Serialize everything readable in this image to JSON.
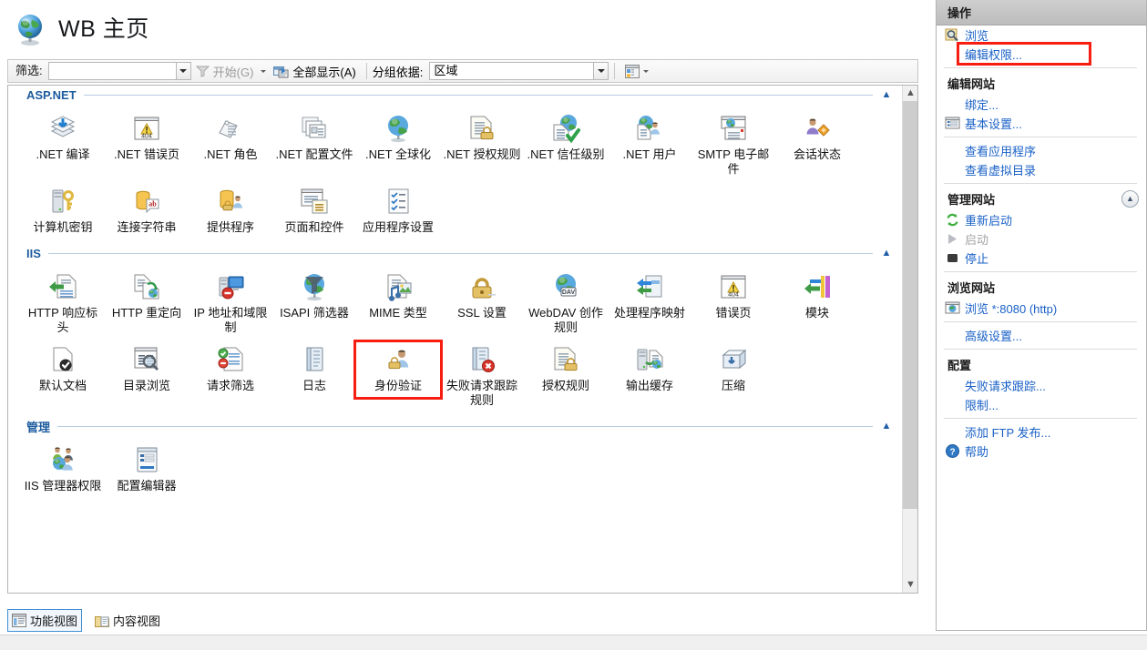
{
  "page": {
    "title": "WB 主页",
    "title_icon": "globe-icon"
  },
  "toolbar": {
    "filter_label": "筛选:",
    "filter_value": "",
    "filter_placeholder": "",
    "start_label": "开始(G)",
    "show_all_label": "全部显示(A)",
    "group_by_label": "分组依据:",
    "group_by_value": "区域"
  },
  "groups": [
    {
      "title": "ASP.NET",
      "items": [
        {
          "label": ".NET 编译",
          "icon": "net-compilation-icon",
          "highlight": false
        },
        {
          "label": ".NET 错误页",
          "icon": "net-error-pages-icon",
          "highlight": false
        },
        {
          "label": ".NET 角色",
          "icon": "net-roles-icon",
          "highlight": false
        },
        {
          "label": ".NET 配置文件",
          "icon": "net-profile-icon",
          "highlight": false
        },
        {
          "label": ".NET 全球化",
          "icon": "net-globalization-icon",
          "highlight": false
        },
        {
          "label": ".NET 授权规则",
          "icon": "net-authorization-icon",
          "highlight": false
        },
        {
          "label": ".NET 信任级别",
          "icon": "net-trust-levels-icon",
          "highlight": false
        },
        {
          "label": ".NET 用户",
          "icon": "net-users-icon",
          "highlight": false
        },
        {
          "label": "SMTP 电子邮件",
          "icon": "smtp-email-icon",
          "highlight": false
        },
        {
          "label": "会话状态",
          "icon": "session-state-icon",
          "highlight": false
        },
        {
          "label": "计算机密钥",
          "icon": "machine-key-icon",
          "highlight": false
        },
        {
          "label": "连接字符串",
          "icon": "connection-strings-icon",
          "highlight": false
        },
        {
          "label": "提供程序",
          "icon": "providers-icon",
          "highlight": false
        },
        {
          "label": "页面和控件",
          "icon": "pages-controls-icon",
          "highlight": false
        },
        {
          "label": "应用程序设置",
          "icon": "app-settings-icon",
          "highlight": false
        }
      ]
    },
    {
      "title": "IIS",
      "items": [
        {
          "label": "HTTP 响应标头",
          "icon": "http-response-headers-icon",
          "highlight": false
        },
        {
          "label": "HTTP 重定向",
          "icon": "http-redirect-icon",
          "highlight": false
        },
        {
          "label": "IP 地址和域限制",
          "icon": "ip-restrictions-icon",
          "highlight": false
        },
        {
          "label": "ISAPI 筛选器",
          "icon": "isapi-filters-icon",
          "highlight": false
        },
        {
          "label": "MIME 类型",
          "icon": "mime-types-icon",
          "highlight": false
        },
        {
          "label": "SSL 设置",
          "icon": "ssl-settings-icon",
          "highlight": false
        },
        {
          "label": "WebDAV 创作规则",
          "icon": "webdav-icon",
          "highlight": false
        },
        {
          "label": "处理程序映射",
          "icon": "handler-mappings-icon",
          "highlight": false
        },
        {
          "label": "错误页",
          "icon": "error-pages-icon",
          "highlight": false
        },
        {
          "label": "模块",
          "icon": "modules-icon",
          "highlight": false
        },
        {
          "label": "默认文档",
          "icon": "default-document-icon",
          "highlight": false
        },
        {
          "label": "目录浏览",
          "icon": "directory-browsing-icon",
          "highlight": false
        },
        {
          "label": "请求筛选",
          "icon": "request-filtering-icon",
          "highlight": false
        },
        {
          "label": "日志",
          "icon": "logging-icon",
          "highlight": false
        },
        {
          "label": "身份验证",
          "icon": "authentication-icon",
          "highlight": true
        },
        {
          "label": "失败请求跟踪规则",
          "icon": "failed-request-tracing-rules-icon",
          "highlight": false
        },
        {
          "label": "授权规则",
          "icon": "authorization-rules-icon",
          "highlight": false
        },
        {
          "label": "输出缓存",
          "icon": "output-caching-icon",
          "highlight": false
        },
        {
          "label": "压缩",
          "icon": "compression-icon",
          "highlight": false
        }
      ]
    },
    {
      "title": "管理",
      "items": [
        {
          "label": "IIS 管理器权限",
          "icon": "iis-manager-permissions-icon",
          "highlight": false
        },
        {
          "label": "配置编辑器",
          "icon": "configuration-editor-icon",
          "highlight": false
        }
      ]
    }
  ],
  "view_tabs": [
    {
      "label": "功能视图",
      "icon": "features-view-icon",
      "selected": true
    },
    {
      "label": "内容视图",
      "icon": "content-view-icon",
      "selected": false
    }
  ],
  "actions": {
    "header": "操作",
    "sections": [
      {
        "heading": null,
        "items": [
          {
            "label": "浏览",
            "icon": "browse-icon",
            "disabled": false,
            "highlight": false
          },
          {
            "label": "编辑权限...",
            "icon": null,
            "disabled": false,
            "highlight": true
          }
        ]
      },
      {
        "heading": "编辑网站",
        "collapsible": false,
        "items": [
          {
            "label": "绑定...",
            "icon": null,
            "disabled": false,
            "highlight": false
          },
          {
            "label": "基本设置...",
            "icon": "basic-settings-icon",
            "disabled": false,
            "highlight": false
          }
        ]
      },
      {
        "heading": null,
        "items": [
          {
            "label": "查看应用程序",
            "icon": null,
            "disabled": false,
            "highlight": false
          },
          {
            "label": "查看虚拟目录",
            "icon": null,
            "disabled": false,
            "highlight": false
          }
        ]
      },
      {
        "heading": "管理网站",
        "collapsible": true,
        "collapse_icon": "chevron-up-icon",
        "items": [
          {
            "label": "重新启动",
            "icon": "restart-icon",
            "disabled": false,
            "highlight": false
          },
          {
            "label": "启动",
            "icon": "start-icon",
            "disabled": true,
            "highlight": false
          },
          {
            "label": "停止",
            "icon": "stop-icon",
            "disabled": false,
            "highlight": false
          }
        ]
      },
      {
        "heading": "浏览网站",
        "collapsible": false,
        "items": [
          {
            "label": "浏览 *:8080 (http)",
            "icon": "browse-site-icon",
            "disabled": false,
            "highlight": false
          }
        ]
      },
      {
        "heading": null,
        "items": [
          {
            "label": "高级设置...",
            "icon": null,
            "disabled": false,
            "highlight": false
          }
        ]
      },
      {
        "heading": "配置",
        "collapsible": false,
        "items": [
          {
            "label": "失败请求跟踪...",
            "icon": null,
            "disabled": false,
            "highlight": false
          },
          {
            "label": "限制...",
            "icon": null,
            "disabled": false,
            "highlight": false
          }
        ]
      },
      {
        "heading": null,
        "items": [
          {
            "label": "添加 FTP 发布...",
            "icon": null,
            "disabled": false,
            "highlight": false
          },
          {
            "label": "帮助",
            "icon": "help-icon",
            "disabled": false,
            "highlight": false
          }
        ]
      }
    ]
  },
  "colors": {
    "highlight_red": "#f71e11",
    "link_blue": "#1a61c7",
    "group_title_blue": "#1d5c9e"
  }
}
